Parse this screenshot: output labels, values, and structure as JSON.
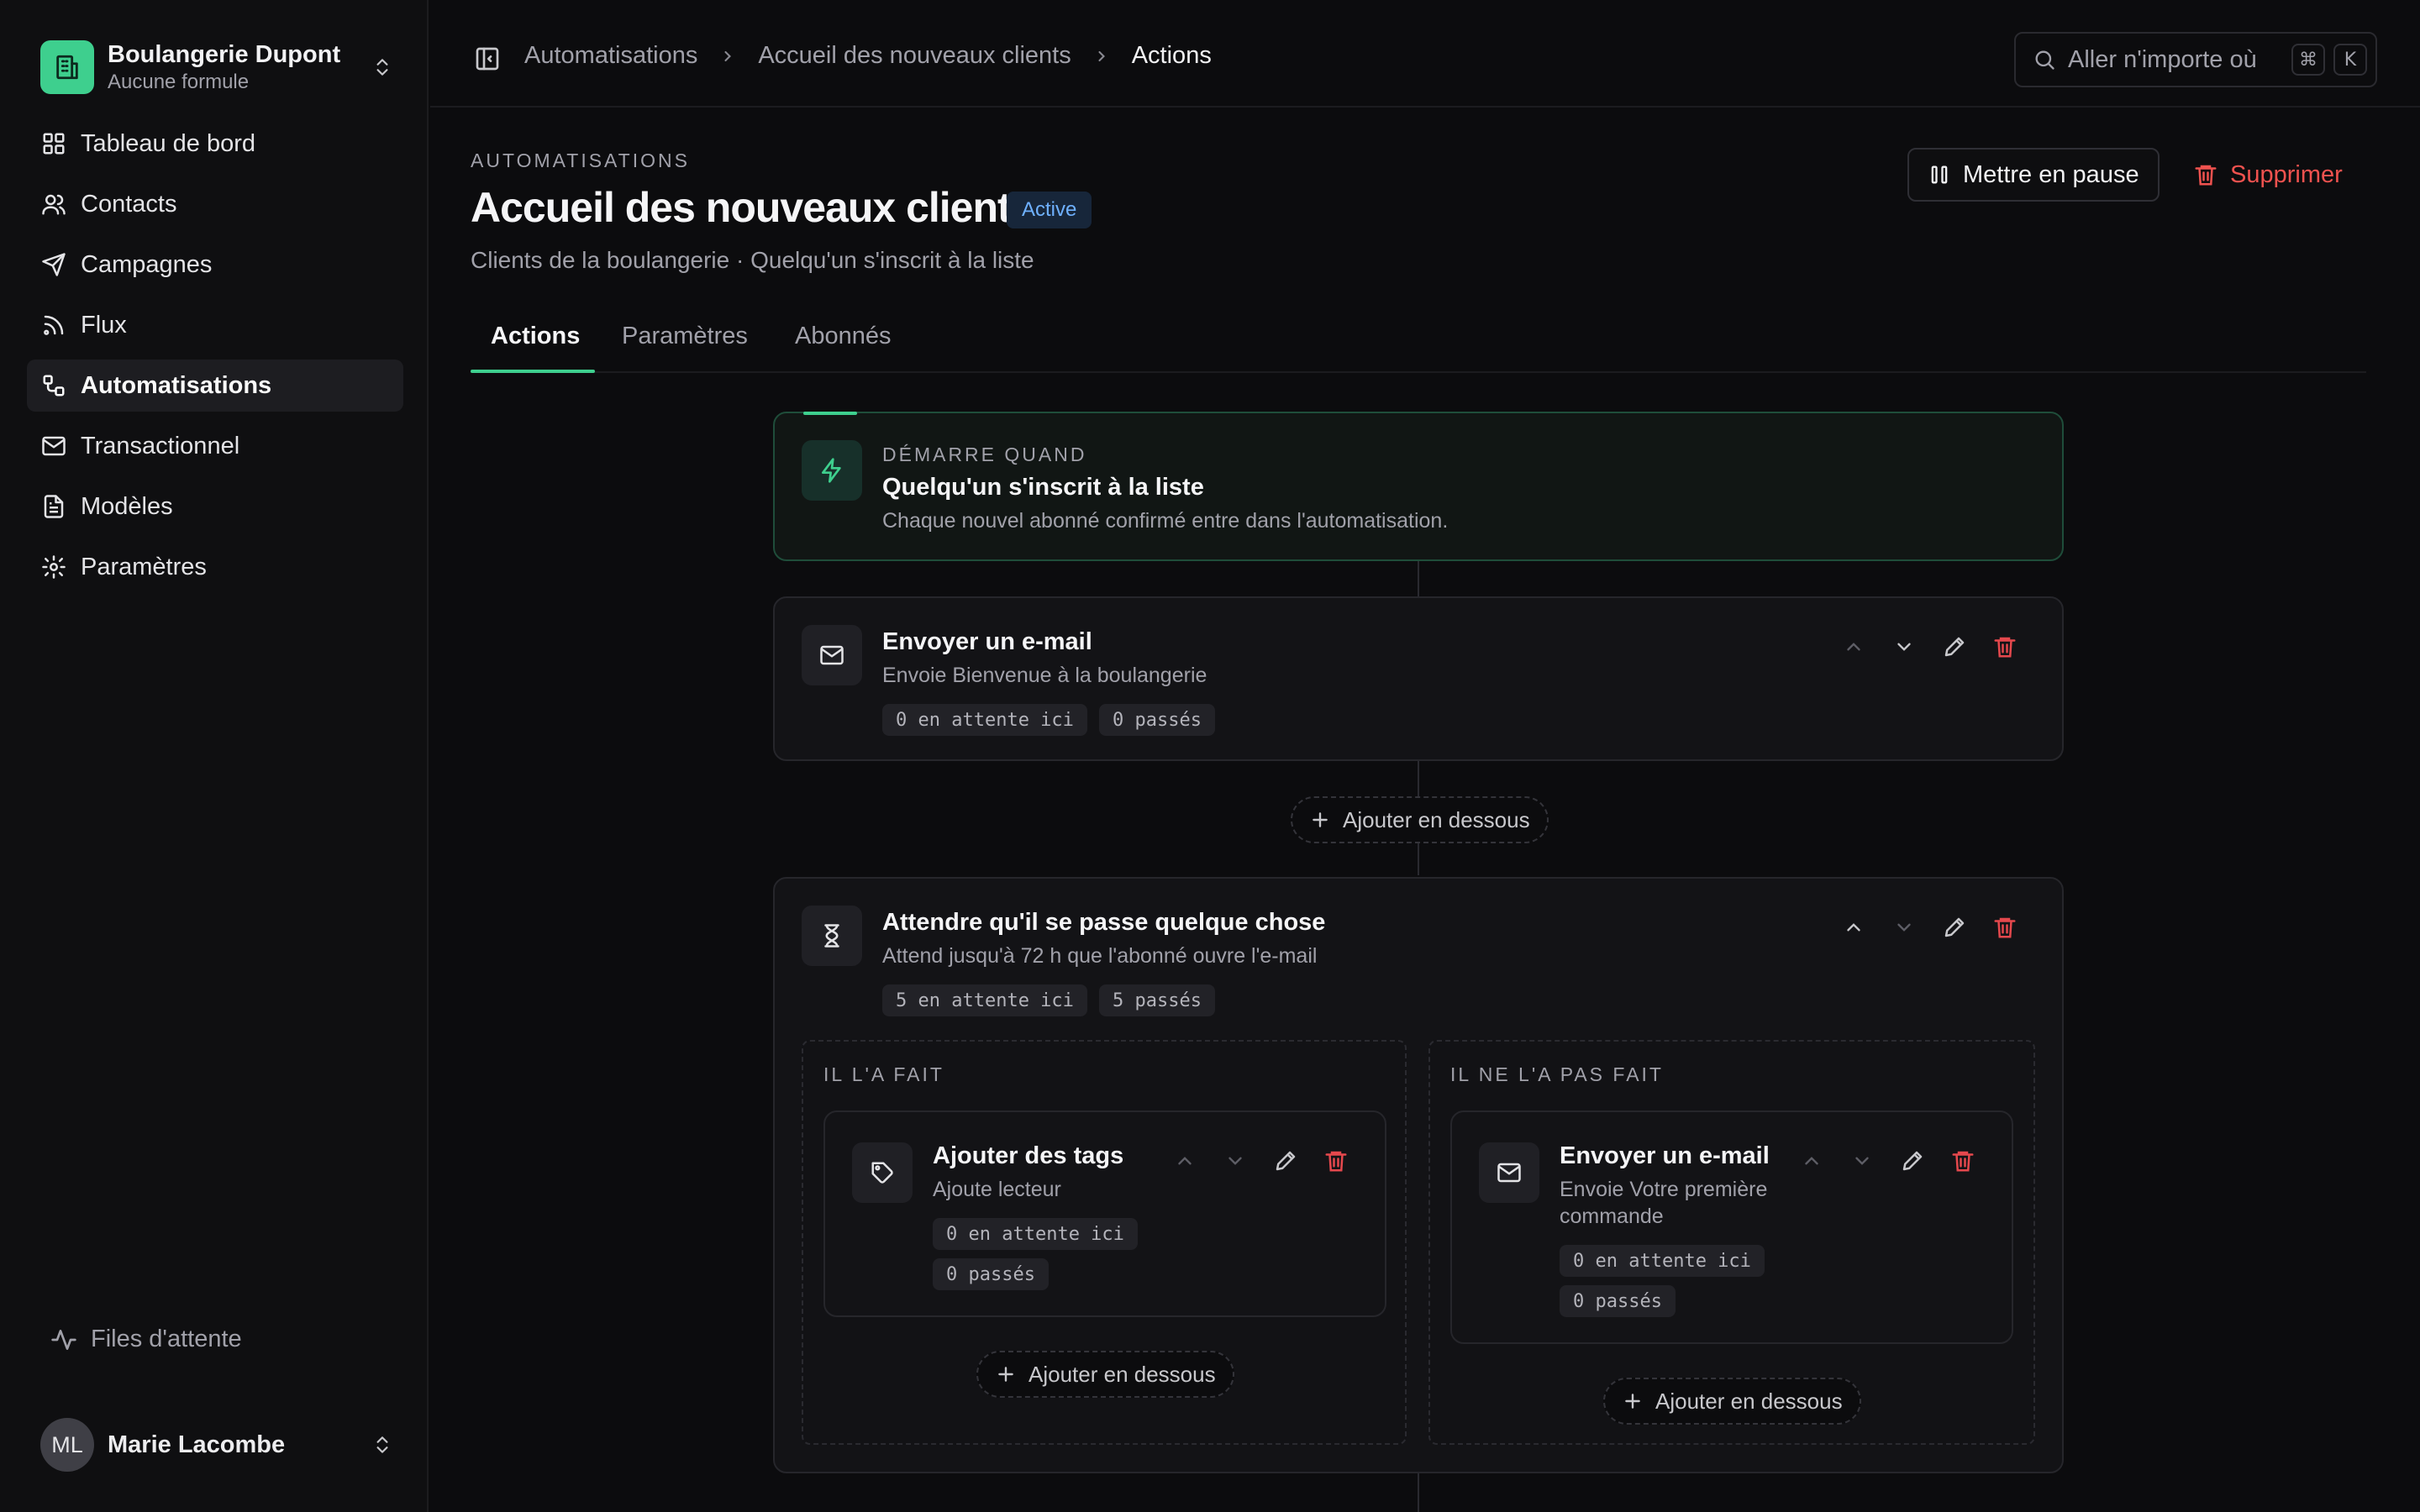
{
  "sidebar": {
    "org_name": "Boulangerie Dupont",
    "org_plan": "Aucune formule",
    "items": [
      {
        "label": "Tableau de bord",
        "icon": "dashboard-icon"
      },
      {
        "label": "Contacts",
        "icon": "users-icon"
      },
      {
        "label": "Campagnes",
        "icon": "send-icon"
      },
      {
        "label": "Flux",
        "icon": "rss-icon"
      },
      {
        "label": "Automatisations",
        "icon": "workflow-icon",
        "active": true
      },
      {
        "label": "Transactionnel",
        "icon": "mail-icon"
      },
      {
        "label": "Modèles",
        "icon": "file-icon"
      },
      {
        "label": "Paramètres",
        "icon": "gear-icon"
      }
    ],
    "queues_label": "Files d'attente",
    "user_initials": "ML",
    "user_name": "Marie Lacombe"
  },
  "topbar": {
    "breadcrumbs": [
      "Automatisations",
      "Accueil des nouveaux clients",
      "Actions"
    ],
    "search_placeholder": "Aller n'importe où",
    "shortcut_keys": [
      "⌘",
      "K"
    ]
  },
  "header": {
    "overline": "AUTOMATISATIONS",
    "title": "Accueil des nouveaux clients",
    "status": "Active",
    "subtitle": "Clients de la boulangerie · Quelqu'un s'inscrit à la liste",
    "pause_label": "Mettre en pause",
    "delete_label": "Supprimer"
  },
  "tabs": [
    {
      "label": "Actions",
      "active": true
    },
    {
      "label": "Paramètres"
    },
    {
      "label": "Abonnés"
    }
  ],
  "flow": {
    "trigger": {
      "overline": "DÉMARRE QUAND",
      "title": "Quelqu'un s'inscrit à la liste",
      "desc": "Chaque nouvel abonné confirmé entre dans l'automatisation."
    },
    "step1": {
      "title": "Envoyer un e-mail",
      "desc": "Envoie Bienvenue à la boulangerie",
      "waiting": "0 en attente ici",
      "passed": "0 passés"
    },
    "add_below": "Ajouter en dessous",
    "step2": {
      "title": "Attendre qu'il se passe quelque chose",
      "desc": "Attend jusqu'à 72 h que l'abonné ouvre l'e-mail",
      "waiting": "5 en attente ici",
      "passed": "5 passés"
    },
    "branch_yes": {
      "label": "IL L'A FAIT",
      "title": "Ajouter des tags",
      "desc": "Ajoute lecteur",
      "waiting": "0 en attente ici",
      "passed": "0 passés"
    },
    "branch_no": {
      "label": "IL NE L'A PAS FAIT",
      "title": "Envoyer un e-mail",
      "desc": "Envoie Votre première commande",
      "waiting": "0 en attente ici",
      "passed": "0 passés"
    }
  },
  "colors": {
    "accent": "#3ecf8e",
    "danger": "#e5484d",
    "status_blue": "#6fb1ff"
  }
}
